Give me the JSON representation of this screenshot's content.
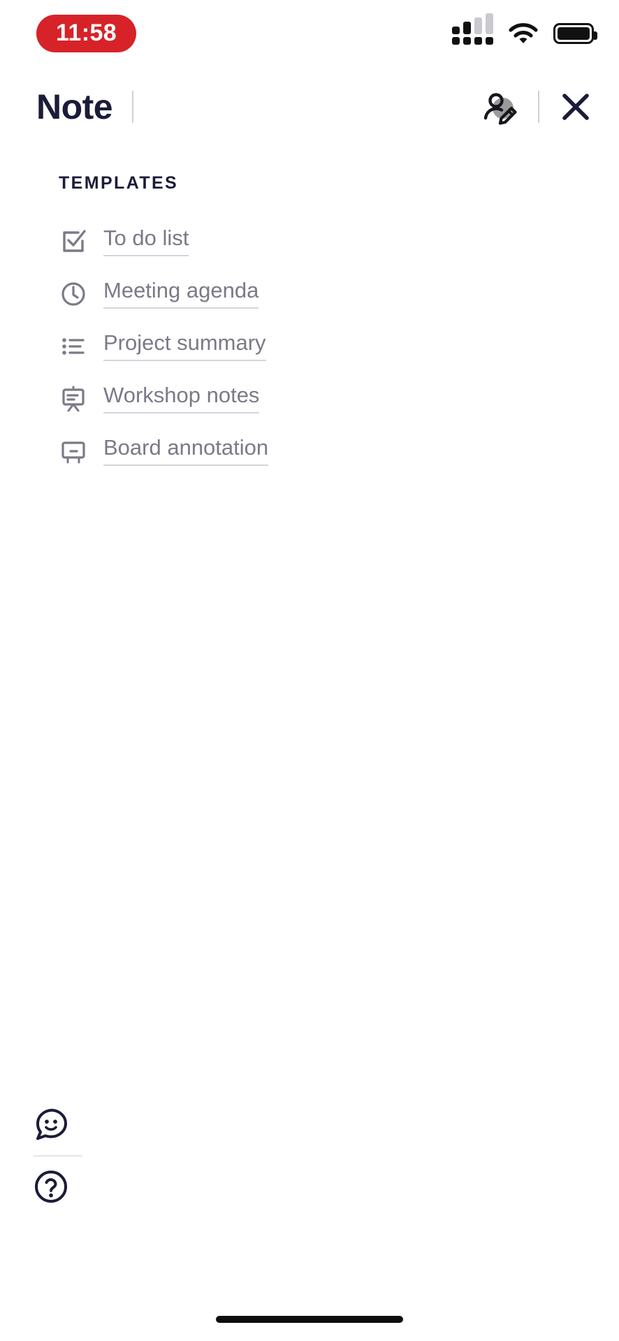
{
  "status_bar": {
    "time": "11:58",
    "time_pill_color": "#D72229",
    "signal_icon": "cellular-signal-icon",
    "wifi_icon": "wifi-icon",
    "battery_icon": "battery-full-icon"
  },
  "header": {
    "title": "Note",
    "divider": "header-divider",
    "collaborate_icon": "person-edit-icon",
    "close_icon": "close-icon",
    "title_color": "#1b1b3a"
  },
  "templates": {
    "section_label": "TEMPLATES",
    "items": [
      {
        "label": "To do list",
        "icon": "checkbox-checked-icon"
      },
      {
        "label": "Meeting agenda",
        "icon": "clock-icon"
      },
      {
        "label": "Project summary",
        "icon": "bulleted-list-icon"
      },
      {
        "label": "Workshop notes",
        "icon": "easel-board-icon"
      },
      {
        "label": "Board annotation",
        "icon": "whiteboard-icon"
      }
    ],
    "label_color": "#7a7a88"
  },
  "bottom_rail": {
    "feedback_icon": "chat-smiley-icon",
    "help_icon": "question-circle-icon"
  },
  "system": {
    "home_indicator": "home-indicator"
  }
}
